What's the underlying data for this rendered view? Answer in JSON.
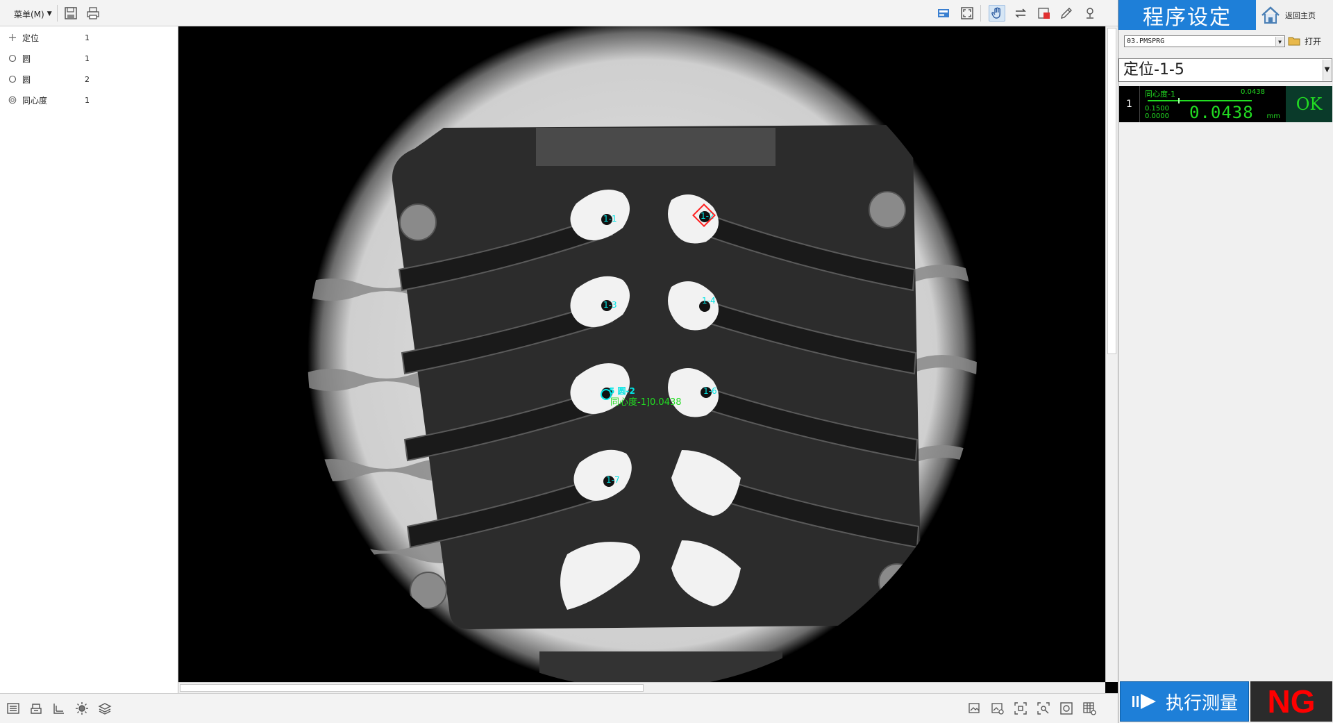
{
  "toolbar": {
    "menu_label": "菜单(M)",
    "left_icons": [
      "save-icon",
      "print-icon"
    ],
    "right_icons": [
      "image-info-icon",
      "fit-screen-icon",
      "hand-pan-icon",
      "flip-icon",
      "color-region-icon",
      "pencil-icon",
      "location-pin-icon"
    ]
  },
  "feature_list": [
    {
      "icon": "crosshair-icon",
      "name": "定位",
      "count": "1"
    },
    {
      "icon": "circle-icon",
      "name": "圆",
      "count": "1"
    },
    {
      "icon": "circle-icon",
      "name": "圆",
      "count": "2"
    },
    {
      "icon": "concentric-icon",
      "name": "同心度",
      "count": "1"
    }
  ],
  "viewport": {
    "pad_labels": [
      "1-1",
      "1-2",
      "1-3",
      "1-4",
      "1-6",
      "1-7"
    ],
    "overlay_circles_label": "5 圆-2",
    "overlay_result_label": "同心度-1]0.0438",
    "overlay_color": "#00e5e5",
    "result_color": "#22dd22",
    "marker_color": "#ff2020"
  },
  "bottom_icons_left": [
    "list-icon",
    "tray-icon",
    "ruler-icon",
    "brightness-icon",
    "layers-icon"
  ],
  "bottom_icons_right": [
    "image-edit-icon",
    "image-check-icon",
    "zoom-fit-icon",
    "zoom-region-icon",
    "capture-icon",
    "table-settings-icon"
  ],
  "right_panel": {
    "title": "程序设定",
    "home_label": "返回主页",
    "program_select": "03.PMSPRG",
    "open_label": "打开",
    "feature_select": "定位-1-5",
    "measurement": {
      "index": "1",
      "name": "同心度-1",
      "top_value": "0.0438",
      "upper_tol": "0.1500",
      "lower_tol": "0.0000",
      "value": "0.0438",
      "unit": "mm",
      "status": "OK",
      "gauge_fraction": 0.29
    },
    "execute_label": "执行测量",
    "result_badge": "NG",
    "accent": "#1e7fd8",
    "ng_color": "#ff0000"
  }
}
